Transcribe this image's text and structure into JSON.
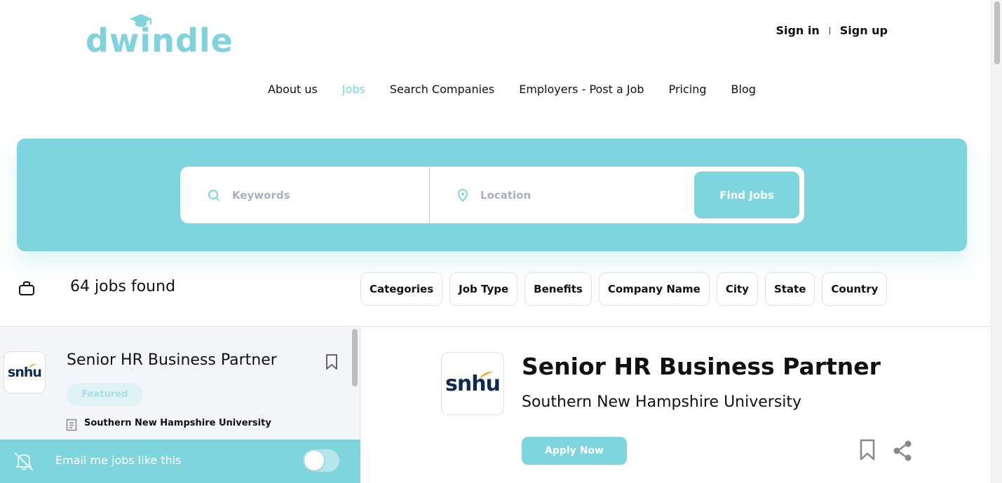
{
  "brand": {
    "name": "dwindle",
    "accent_color": "#7fd5dd"
  },
  "auth": {
    "sign_in": "Sign in",
    "sign_up": "Sign up"
  },
  "nav": {
    "items": [
      {
        "label": "About us",
        "active": false
      },
      {
        "label": "Jobs",
        "active": true
      },
      {
        "label": "Search Companies",
        "active": false
      },
      {
        "label": "Employers - Post a Job",
        "active": false
      },
      {
        "label": "Pricing",
        "active": false
      },
      {
        "label": "Blog",
        "active": false
      }
    ]
  },
  "search": {
    "keywords_placeholder": "Keywords",
    "keywords_value": "",
    "location_placeholder": "Location",
    "location_value": "",
    "button_label": "Find Jobs",
    "keywords_icon": "search-icon",
    "location_icon": "map-pin-icon"
  },
  "results": {
    "count_text": "64 jobs found",
    "icon": "briefcase-icon",
    "filters": [
      "Categories",
      "Job Type",
      "Benefits",
      "Company Name",
      "City",
      "State",
      "Country"
    ]
  },
  "job_list": [
    {
      "title": "Senior HR Business Partner",
      "badge": "Featured",
      "company": "Southern New Hampshire University",
      "logo_text": "snhu"
    }
  ],
  "email_alert": {
    "label": "Email me jobs like this",
    "enabled": false
  },
  "detail": {
    "title": "Senior HR Business Partner",
    "company": "Southern New Hampshire University",
    "logo_text": "snhu",
    "apply_label": "Apply Now"
  }
}
